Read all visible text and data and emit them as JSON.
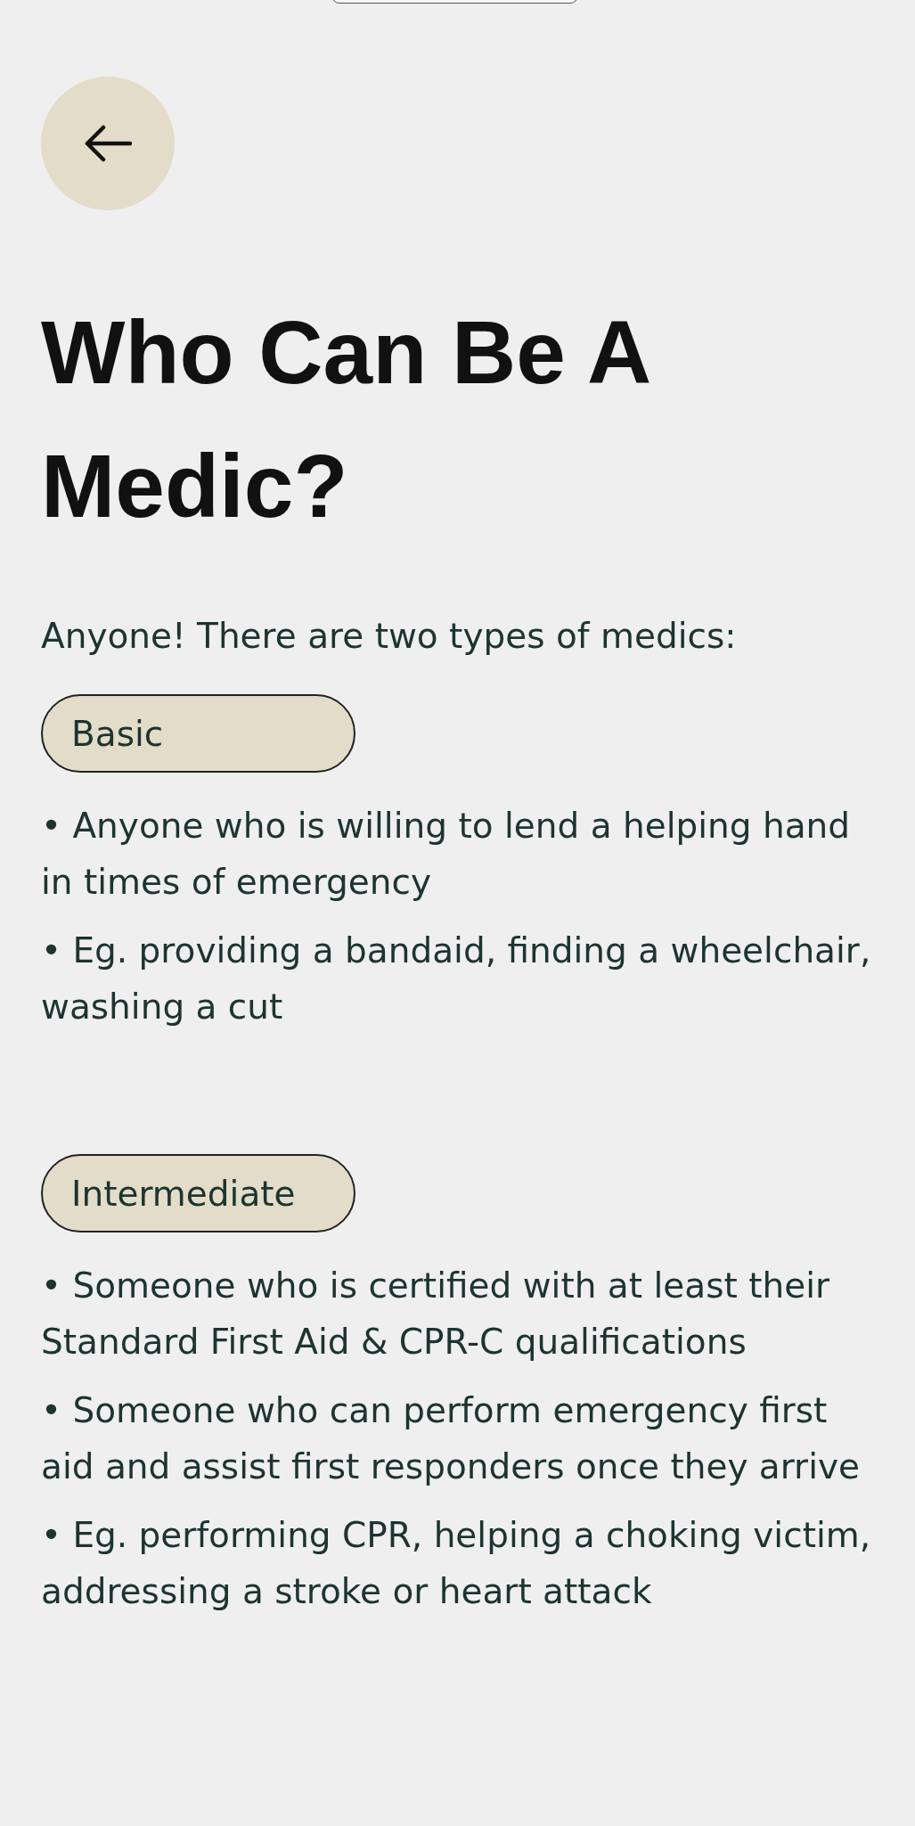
{
  "title": "Who Can Be A Medic?",
  "intro": "Anyone! There are two types of medics:",
  "sections": [
    {
      "tag": "Basic",
      "bullets": [
        "• Anyone who is willing to lend a helping hand in times of emergency",
        "• Eg. providing a bandaid, finding a wheelchair, washing a cut"
      ]
    },
    {
      "tag": "Intermediate",
      "bullets": [
        "• Someone who is certified with at least their Standard First Aid & CPR-C qualifications",
        "• Someone who can perform emergency first aid and assist first responders once they arrive",
        "• Eg. performing CPR, helping a choking victim, addressing a stroke or heart attack"
      ]
    }
  ]
}
